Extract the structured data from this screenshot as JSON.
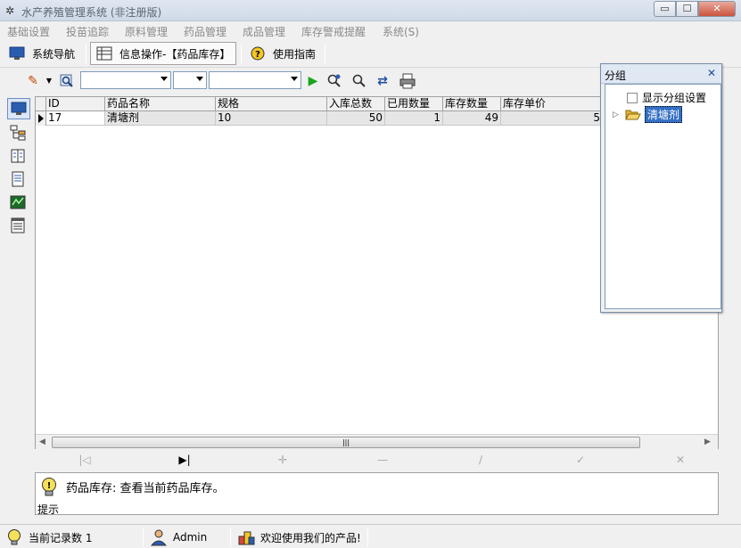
{
  "window": {
    "title": "水产养殖管理系统 (非注册版)",
    "min_label": "▭",
    "max_label": "☐",
    "close_label": "✕"
  },
  "menu": [
    "基础设置",
    "投苗追踪",
    "原料管理",
    "药品管理",
    "成品管理",
    "库存警戒提醒",
    "系统(S)"
  ],
  "navbar": {
    "nav_label": "系统导航",
    "info_tab_label": "信息操作-【药品库存】",
    "guide_label": "使用指南"
  },
  "grid": {
    "columns": [
      "ID",
      "药品名称",
      "规格",
      "入库总数",
      "已用数量",
      "库存数量",
      "库存单价"
    ],
    "rows": [
      {
        "id": "17",
        "name": "清塘剂",
        "spec": "10",
        "total_in": "50",
        "used": "1",
        "stock": "49",
        "price": "5"
      }
    ]
  },
  "hint": {
    "label": "提示",
    "text": "药品库存: 查看当前药品库存。"
  },
  "status": {
    "record_count": "当前记录数 1",
    "user": "Admin",
    "welcome": "欢迎使用我们的产品!"
  },
  "group_panel": {
    "title": "分组",
    "checkbox_label": "显示分组设置",
    "tree_item": "清塘剂"
  },
  "colors": {
    "selection": "#3470c5",
    "accent_border": "#7f9db9"
  }
}
